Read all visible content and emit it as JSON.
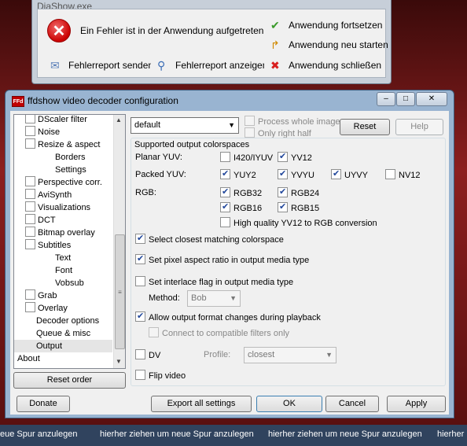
{
  "background": {
    "taskbar_items": [
      "eue Spur anzulegen",
      "hierher ziehen um neue Spur anzulegen",
      "hierher ziehen um neue Spur anzulegen",
      "hierher ziehen um neue Spur anzulegen",
      "hierher"
    ]
  },
  "error_dialog": {
    "title": "DiaShow.exe",
    "message": "Ein Fehler ist in der Anwendung aufgetreten.",
    "buttons": {
      "continue": "Anwendung fortsetzen",
      "restart": "Anwendung neu starten",
      "send_report": "Fehlerreport senden",
      "show_report": "Fehlerreport anzeigen",
      "close_app": "Anwendung schließen"
    },
    "icons": {
      "error": "error-icon",
      "check": "check-icon",
      "restart": "restart-arrow-icon",
      "mail": "mail-icon",
      "magnifier": "magnifier-icon",
      "close": "red-x-icon"
    }
  },
  "window": {
    "title": "ffdshow video decoder configuration",
    "app_icon_text": "FFd",
    "controls": {
      "minimize": "–",
      "maximize": "□",
      "close": "✕"
    }
  },
  "tree": {
    "items": [
      {
        "label": "DScaler filter",
        "check": true,
        "checked": false,
        "indent": 0
      },
      {
        "label": "Noise",
        "check": true,
        "checked": false,
        "indent": 0
      },
      {
        "label": "Resize & aspect",
        "check": true,
        "checked": false,
        "indent": 0
      },
      {
        "label": "Borders",
        "check": false,
        "indent": 2
      },
      {
        "label": "Settings",
        "check": false,
        "indent": 2
      },
      {
        "label": "Perspective corr.",
        "check": true,
        "checked": false,
        "indent": 0
      },
      {
        "label": "AviSynth",
        "check": true,
        "checked": false,
        "indent": 0
      },
      {
        "label": "Visualizations",
        "check": true,
        "checked": false,
        "indent": 0
      },
      {
        "label": "DCT",
        "check": true,
        "checked": false,
        "indent": 0
      },
      {
        "label": "Bitmap overlay",
        "check": true,
        "checked": false,
        "indent": 0
      },
      {
        "label": "Subtitles",
        "check": true,
        "checked": false,
        "indent": 0
      },
      {
        "label": "Text",
        "check": false,
        "indent": 2
      },
      {
        "label": "Font",
        "check": false,
        "indent": 2
      },
      {
        "label": "Vobsub",
        "check": false,
        "indent": 2
      },
      {
        "label": "Grab",
        "check": true,
        "checked": false,
        "indent": 0
      },
      {
        "label": "Overlay",
        "check": true,
        "checked": false,
        "indent": 0
      },
      {
        "label": "Decoder options",
        "check": false,
        "indent": 1
      },
      {
        "label": "Queue & misc",
        "check": false,
        "indent": 1
      },
      {
        "label": "Output",
        "check": false,
        "indent": 1,
        "selected": true
      },
      {
        "label": "About",
        "check": false,
        "indent": -1
      }
    ]
  },
  "top": {
    "preset": "default",
    "process_whole_image": "Process whole image",
    "only_right_half": "Only right half",
    "reset": "Reset",
    "help": "Help"
  },
  "output": {
    "group_title": "Supported output colorspaces",
    "planar_label": "Planar YUV:",
    "packed_label": "Packed YUV:",
    "rgb_label": "RGB:",
    "planar": [
      {
        "label": "I420/IYUV",
        "checked": false
      },
      {
        "label": "YV12",
        "checked": true
      }
    ],
    "packed": [
      {
        "label": "YUY2",
        "checked": true
      },
      {
        "label": "YVYU",
        "checked": true
      },
      {
        "label": "UYVY",
        "checked": true
      },
      {
        "label": "NV12",
        "checked": false
      }
    ],
    "rgb": [
      {
        "label": "RGB32",
        "checked": true
      },
      {
        "label": "RGB24",
        "checked": true
      },
      {
        "label": "RGB16",
        "checked": true
      },
      {
        "label": "RGB15",
        "checked": true
      }
    ],
    "hq_conversion": {
      "label": "High quality YV12 to RGB conversion",
      "checked": false
    },
    "select_closest": {
      "label": "Select closest matching colorspace",
      "checked": true
    },
    "set_pixel_aspect": {
      "label": "Set pixel aspect ratio in output media type",
      "checked": true
    },
    "set_interlace": {
      "label": "Set interlace flag in output media type",
      "checked": false
    },
    "method_label": "Method:",
    "method_value": "Bob",
    "allow_changes": {
      "label": "Allow output format changes during playback",
      "checked": true
    },
    "connect_compatible": {
      "label": "Connect to compatible filters only",
      "checked": false
    },
    "dv": {
      "label": "DV",
      "checked": false
    },
    "profile_label": "Profile:",
    "profile_value": "closest",
    "flip_video": {
      "label": "Flip video",
      "checked": false
    }
  },
  "bottom": {
    "reset_order": "Reset order",
    "donate": "Donate",
    "export_all": "Export all settings",
    "ok": "OK",
    "cancel": "Cancel",
    "apply": "Apply"
  }
}
